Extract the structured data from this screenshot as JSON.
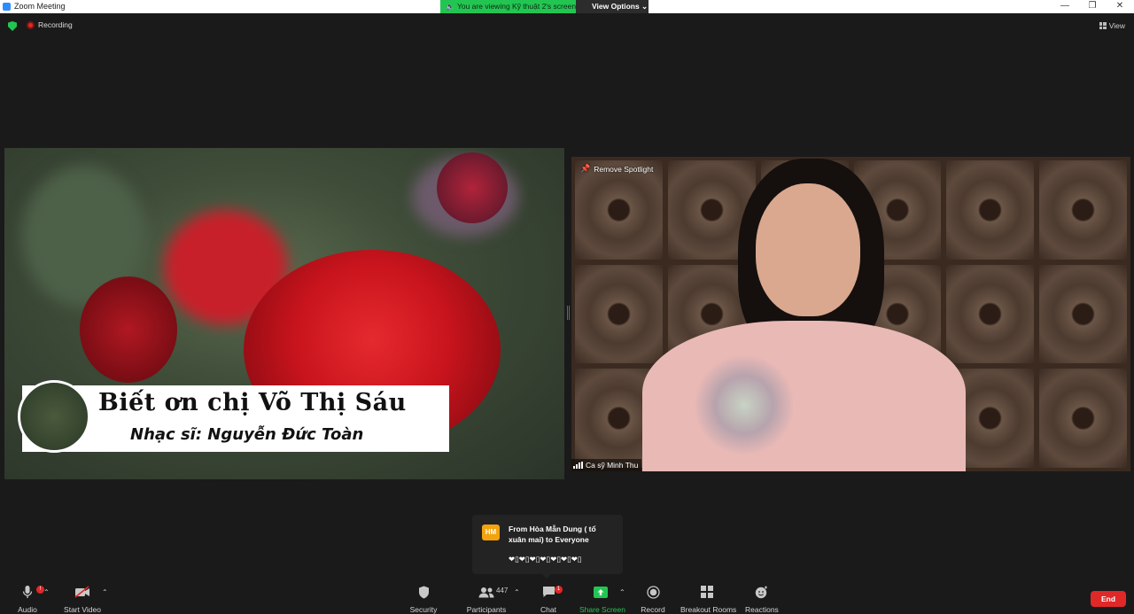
{
  "window": {
    "title": "Zoom Meeting",
    "minimize": "—",
    "restore": "❐",
    "close": "✕"
  },
  "banner": {
    "viewing_text": "You are viewing Kỹ thuật 2's screen",
    "view_options": "View Options ⌄"
  },
  "status": {
    "recording": "Recording",
    "view": "View"
  },
  "shared_video": {
    "caption_title": "Biết ơn chị Võ Thị Sáu",
    "caption_subtitle": "Nhạc sĩ: Nguyễn Đức Toàn"
  },
  "speaker_video": {
    "remove_spotlight": "Remove Spotlight",
    "name": "Ca sỹ Minh Thu"
  },
  "chat_popup": {
    "avatar_initials": "HM",
    "from": "From Hòa Mẫn Dung ( tổ xuân mai) to Everyone",
    "message": "❤▯❤▯❤▯❤▯❤▯❤▯❤▯"
  },
  "toolbar": {
    "audio": "Audio",
    "audio_badge": "!",
    "start_video": "Start Video",
    "security": "Security",
    "participants": "Participants",
    "participants_count": "447",
    "chat": "Chat",
    "chat_badge": "1",
    "share_screen": "Share Screen",
    "record": "Record",
    "breakout_rooms": "Breakout Rooms",
    "reactions": "Reactions",
    "end": "End"
  },
  "colors": {
    "accent_green": "#23c552",
    "end_red": "#e02828",
    "background": "#1a1a1a"
  }
}
